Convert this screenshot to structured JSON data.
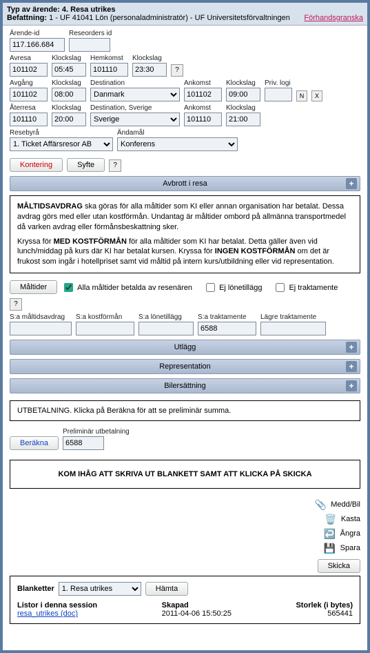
{
  "header": {
    "typeLabel": "Typ av ärende:",
    "typeValue": "4. Resa utrikes",
    "roleLabel": "Befattning:",
    "roleValue": "1 - UF 41041 Lön (personaladministratör) - UF Universitetsförvaltningen",
    "preview": "Förhandsgranska"
  },
  "fields": {
    "arendeId": {
      "label": "Ärende-id",
      "value": "117.166.684"
    },
    "reseorderId": {
      "label": "Reseorders id",
      "value": ""
    },
    "avresa": {
      "label": "Avresa",
      "value": "101102"
    },
    "klock1": {
      "label": "Klockslag",
      "value": "05:45"
    },
    "hemkomst": {
      "label": "Hemkomst",
      "value": "101110"
    },
    "klock2": {
      "label": "Klockslag",
      "value": "23:30"
    },
    "avgang": {
      "label": "Avgång",
      "value": "101102"
    },
    "klock3": {
      "label": "Klockslag",
      "value": "08:00"
    },
    "destination": {
      "label": "Destination",
      "value": "Danmark"
    },
    "ankomst": {
      "label": "Ankomst",
      "value": "101102"
    },
    "klock4": {
      "label": "Klockslag",
      "value": "09:00"
    },
    "privlogi": {
      "label": "Priv. logi",
      "value": ""
    },
    "aterresa": {
      "label": "Återresa",
      "value": "101110"
    },
    "klock5": {
      "label": "Klockslag",
      "value": "20:00"
    },
    "destSverige": {
      "label": "Destination, Sverige",
      "value": "Sverige"
    },
    "ankomst2": {
      "label": "Ankomst",
      "value": "101110"
    },
    "klock6": {
      "label": "Klockslag",
      "value": "21:00"
    },
    "resebyra": {
      "label": "Resebyrå",
      "value": "1. Ticket Affärsresor AB"
    },
    "andamal": {
      "label": "Ändamål",
      "value": "Konferens"
    }
  },
  "buttons": {
    "kontering": "Kontering",
    "syfte": "Syfte",
    "maltider": "Måltider",
    "berakna": "Beräkna",
    "hamta": "Hämta",
    "skicka": "Skicka",
    "n": "N",
    "x": "X",
    "q": "?"
  },
  "bands": {
    "avbrott": "Avbrott i resa",
    "utlagg": "Utlägg",
    "representation": "Representation",
    "bilers": "Bilersättning"
  },
  "info": {
    "p1a": "MÅLTIDSAVDRAG",
    "p1b": " ska göras för alla måltider som KI eller annan organisation har betalat. Dessa avdrag görs med eller utan kostförmån. Undantag är måltider ombord på allmänna transportmedel då varken avdrag eller förmånsbeskattning sker.",
    "p2a": "Kryssa för ",
    "p2b": "MED KOSTFÖRMÅN",
    "p2c": " för alla måltider som KI har betalat. Detta gäller även vid lunch/middag på kurs där KI har betalat kursen. Kryssa för ",
    "p2d": "INGEN KOSTFÖRMÅN",
    "p2e": " om det är frukost som ingår i hotellpriset samt vid måltid på intern kurs/utbildning eller vid representation."
  },
  "checks": {
    "alla": "Alla måltider betalda av resenären",
    "ejlon": "Ej lönetillägg",
    "ejtrakt": "Ej traktamente"
  },
  "sums": {
    "maltid": {
      "label": "S:a måltidsavdrag",
      "value": ""
    },
    "kost": {
      "label": "S:a kostförmån",
      "value": ""
    },
    "lon": {
      "label": "S:a lönetillägg",
      "value": ""
    },
    "trakt": {
      "label": "S:a traktamente",
      "value": "6588"
    },
    "lagre": {
      "label": "Lägre traktamente",
      "value": ""
    }
  },
  "utbet": {
    "msg": "UTBETALNING. Klicka på Beräkna för att se preliminär summa.",
    "prelLabel": "Preliminär utbetalning",
    "prelValue": "6588"
  },
  "remind": "KOM IHÅG ATT SKRIVA UT BLANKETT SAMT ATT KLICKA PÅ SKICKA",
  "actions": {
    "medd": "Medd/Bil",
    "kasta": "Kasta",
    "angra": "Ångra",
    "spara": "Spara"
  },
  "footer": {
    "blanketter": "Blanketter",
    "blankVal": "1. Resa utrikes",
    "listor": "Listor i denna session",
    "file": "resa_utrikes (doc)",
    "skapad": "Skapad",
    "skapadVal": "2011-04-06 15:50:25",
    "storlek": "Storlek (i bytes)",
    "storlekVal": "565441"
  }
}
